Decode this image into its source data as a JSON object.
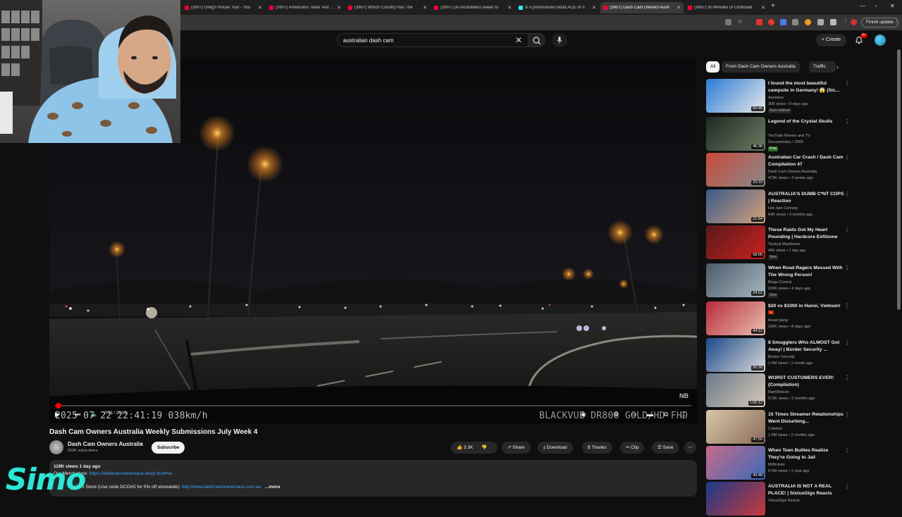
{
  "browser": {
    "tabs": [
      {
        "title": "(3907) Greg's House Tour - You",
        "type": "yt"
      },
      {
        "title": "(3907) Americans Taste Test Au",
        "type": "yt"
      },
      {
        "title": "(3907) Which Country Has The",
        "type": "yt"
      },
      {
        "title": "(3907) Do Australians swear to",
        "type": "yt"
      },
      {
        "title": "Is it pronounced neckLACE or n",
        "type": "tt"
      },
      {
        "title": "(3907) Dash Cam Owners Austr",
        "type": "yt",
        "active": true
      },
      {
        "title": "(3907) 30 Minutes of Confused",
        "type": "yt"
      }
    ],
    "new_tab": "+",
    "finish_update": "Finish update"
  },
  "header": {
    "search_value": "australian dash cam",
    "create_label": "Create",
    "notif_count": "9+"
  },
  "player": {
    "osd_timestamp": "2025 07 22 22:41:19 038km/h",
    "osd_brand": "BLACKVUE DR800 GOLD/HD FHD",
    "time_label": "0:06 / 29:19",
    "progress": 0.006
  },
  "video": {
    "title": "Dash Cam Owners Australia Weekly Submissions July Week 4",
    "channel": "Dash Cam Owners Australia",
    "subscribers": "553K subscribers",
    "subscribe_label": "Subscribe",
    "likes": "3.3K",
    "share_label": "Share",
    "download_label": "Download",
    "thanks_label": "Thanks",
    "clip_label": "Clip",
    "save_label": "Save",
    "views_date": "119K views  1 day ago",
    "desc_line1_prefix": "Our Merch store: ",
    "desc_line1_link": "https://dashcamownersaus-shop.fourthw...",
    "desc_line2_prefix": "Cam Store (Use code DCOA5 for 5% off storewide): ",
    "desc_line2_link": "http://www.dashcamownersaus.com.au",
    "desc_more": "...more"
  },
  "overlay": {
    "streamer_logo": "Simo"
  },
  "sidebar": {
    "chips": [
      "All",
      "From Dash Cam Owners Australia",
      "Traffic"
    ],
    "recommendations": [
      {
        "title": "I found the most beautiful campsite in Germany! 😱 (Sic...",
        "channel": "Annatour",
        "meta": "30K views • 9 days ago",
        "badge": "Auto-dubbed",
        "duration": "50:45",
        "colors": [
          "#2a7bd6",
          "#e8e8e8"
        ]
      },
      {
        "title": "Legend of the Crystal Skulls",
        "channel": "YouTube Movies and TV",
        "meta": "Documentary • 2009",
        "badge": "Free",
        "duration": "46:36",
        "colors": [
          "#1c2a22",
          "#6d7a62"
        ]
      },
      {
        "title": "Australian Car Crash / Dash Cam Compilation 47",
        "channel": "Dash Cam Owners Australia",
        "meta": "473K views • 3 weeks ago",
        "badge": "",
        "duration": "23:33",
        "colors": [
          "#c84a3a",
          "#8a8a8a"
        ]
      },
      {
        "title": "AUSTRALIA'S DUMB C*NT COPS | Reaction",
        "channel": "Hot Jam Comedy",
        "meta": "64K views • 3 months ago",
        "badge": "",
        "duration": "21:54",
        "colors": [
          "#3a5a8a",
          "#d6a27a"
        ]
      },
      {
        "title": "These Raids Got My Heart Pounding | Hardcore Exfilzone",
        "channel": "Tactical Maddness",
        "meta": "446 views • 1 day ago",
        "badge": "New",
        "duration": "58:05",
        "colors": [
          "#5a1a1a",
          "#c82020"
        ]
      },
      {
        "title": "When Road Ragers Messed With The Wrong Person!",
        "channel": "Binge Central",
        "meta": "220K views • 4 days ago",
        "badge": "New",
        "duration": "24:01",
        "colors": [
          "#4a5a6a",
          "#a8b8c0"
        ]
      },
      {
        "title": "$20 vs $1000 in Hanoi, Vietnam! 🇻🇳",
        "channel": "bread gang",
        "meta": "160K views • 8 days ago",
        "badge": "",
        "duration": "44:12",
        "colors": [
          "#b82a3a",
          "#e8c0b0"
        ]
      },
      {
        "title": "8 Smugglers Who ALMOST Got Away! | Border Security ...",
        "channel": "Border Security",
        "meta": "2.6M views • 1 month ago",
        "badge": "",
        "duration": "50:30",
        "colors": [
          "#1a4a8a",
          "#d8d8d8"
        ]
      },
      {
        "title": "WORST CUSTOMERS EVER! (Compilation)",
        "channel": "RamWelcon",
        "meta": "572K views • 2 months ago",
        "badge": "",
        "duration": "1:00:12",
        "colors": [
          "#6a7a8a",
          "#d8c8b8"
        ]
      },
      {
        "title": "15 Times Streamer Relationships Went Disturbing...",
        "channel": "Celebrix",
        "meta": "1.5M views • 2 months ago",
        "badge": "",
        "duration": "47:50",
        "colors": [
          "#d8c8a8",
          "#8a6a5a"
        ]
      },
      {
        "title": "When Teen Bullies Realize They're Going to Jail",
        "channel": "MrBroken",
        "meta": "9.5M views • 1 year ago",
        "badge": "",
        "duration": "43:48",
        "colors": [
          "#c86a8a",
          "#3a6ab8"
        ]
      },
      {
        "title": "AUSTRALIA IS NOT A REAL PLACE! | SixtusGigs Reacts",
        "channel": "SixtusGigs Reacts",
        "meta": "",
        "badge": "",
        "duration": "",
        "colors": [
          "#1a3a8a",
          "#c83a3a"
        ]
      }
    ]
  }
}
